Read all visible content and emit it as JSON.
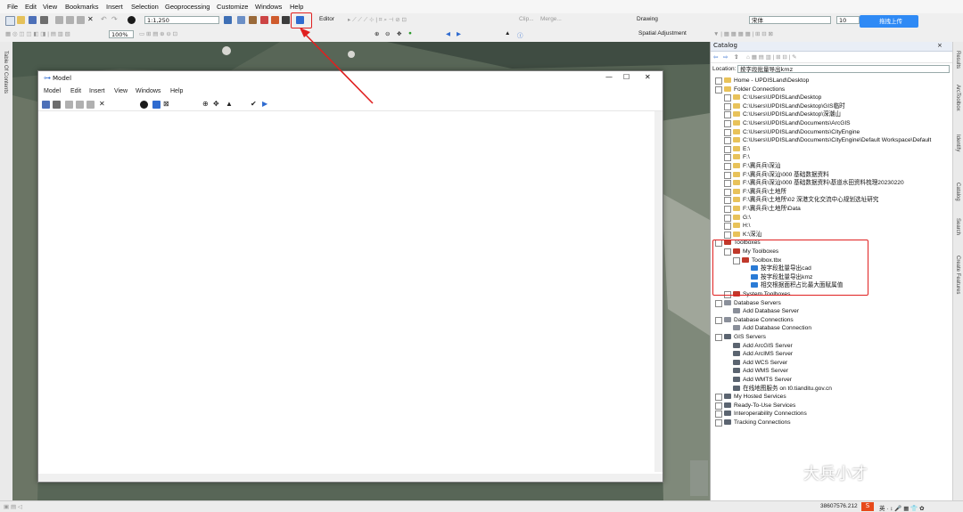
{
  "menu": [
    "File",
    "Edit",
    "View",
    "Bookmarks",
    "Insert",
    "Selection",
    "Geoprocessing",
    "Customize",
    "Windows",
    "Help"
  ],
  "toolbar": {
    "scale": "1:1,250",
    "editor": "Editor",
    "clip": "Clip...",
    "merge": "Merge...",
    "drawing": "Drawing",
    "font_name": "宋体",
    "font_size": "10",
    "zoom": "100%",
    "spatial_adjustment": "Spatial Adjustment",
    "upload_button": "拖拽上传"
  },
  "left_tabs": [
    "Table Of Contents"
  ],
  "model": {
    "title": "Model",
    "menu": [
      "Model",
      "Edit",
      "Insert",
      "View",
      "Windows",
      "Help"
    ],
    "controls": {
      "minimize": "—",
      "maximize": "☐",
      "close": "✕"
    }
  },
  "catalog": {
    "title": "Catalog",
    "location_label": "Location:",
    "location_value": "按字段批量导出kmz",
    "items": [
      {
        "level": 0,
        "exp": "⊞",
        "icon": "folder",
        "label": "Home - UPDISLand\\Desktop"
      },
      {
        "level": 0,
        "exp": "⊟",
        "icon": "folder",
        "label": "Folder Connections"
      },
      {
        "level": 1,
        "exp": "⊞",
        "icon": "folder",
        "label": "C:\\Users\\UPDISLand\\Desktop"
      },
      {
        "level": 1,
        "exp": "⊞",
        "icon": "folder",
        "label": "C:\\Users\\UPDISLand\\Desktop\\GIS临时"
      },
      {
        "level": 1,
        "exp": "⊞",
        "icon": "folder",
        "label": "C:\\Users\\UPDISLand\\Desktop\\深潮山"
      },
      {
        "level": 1,
        "exp": "⊞",
        "icon": "folder",
        "label": "C:\\Users\\UPDISLand\\Documents\\ArcGIS"
      },
      {
        "level": 1,
        "exp": "⊞",
        "icon": "folder",
        "label": "C:\\Users\\UPDISLand\\Documents\\CityEngine"
      },
      {
        "level": 1,
        "exp": "⊞",
        "icon": "folder",
        "label": "C:\\Users\\UPDISLand\\Documents\\CityEngine\\Default Workspace\\Default"
      },
      {
        "level": 1,
        "exp": "⊞",
        "icon": "folder",
        "label": "E:\\"
      },
      {
        "level": 1,
        "exp": "⊞",
        "icon": "folder",
        "label": "F:\\"
      },
      {
        "level": 1,
        "exp": "⊞",
        "icon": "folder",
        "label": "F:\\冀兵兵\\深汕"
      },
      {
        "level": 1,
        "exp": "⊞",
        "icon": "folder",
        "label": "F:\\冀兵兵\\深汕\\000 基础数据资料"
      },
      {
        "level": 1,
        "exp": "⊞",
        "icon": "folder",
        "label": "F:\\冀兵兵\\深汕\\000 基础数据资料\\基道水田资料梳理20230220"
      },
      {
        "level": 1,
        "exp": "⊞",
        "icon": "folder",
        "label": "F:\\冀兵兵\\土地所"
      },
      {
        "level": 1,
        "exp": "⊞",
        "icon": "folder",
        "label": "F:\\冀兵兵\\土地所\\02  深港文化交流中心规划选址研究"
      },
      {
        "level": 1,
        "exp": "⊞",
        "icon": "folder",
        "label": "F:\\冀兵兵\\土地所\\Data"
      },
      {
        "level": 1,
        "exp": "⊞",
        "icon": "folder",
        "label": "G:\\"
      },
      {
        "level": 1,
        "exp": "⊞",
        "icon": "folder",
        "label": "H:\\"
      },
      {
        "level": 1,
        "exp": "⊞",
        "icon": "folder",
        "label": "K:\\深汕"
      },
      {
        "level": 0,
        "exp": "⊟",
        "icon": "toolbox",
        "label": "Toolboxes"
      },
      {
        "level": 1,
        "exp": "⊟",
        "icon": "toolbox",
        "label": "My Toolboxes"
      },
      {
        "level": 2,
        "exp": "⊟",
        "icon": "toolbox",
        "label": "Toolbox.tbx"
      },
      {
        "level": 3,
        "exp": "",
        "icon": "model",
        "label": "按字段批量导出cad"
      },
      {
        "level": 3,
        "exp": "",
        "icon": "model",
        "label": "按字段批量导出kmz"
      },
      {
        "level": 3,
        "exp": "",
        "icon": "model",
        "label": "相交根据面积占比最大面赋属值"
      },
      {
        "level": 1,
        "exp": "⊞",
        "icon": "toolbox",
        "label": "System Toolboxes"
      },
      {
        "level": 0,
        "exp": "⊟",
        "icon": "db",
        "label": "Database Servers"
      },
      {
        "level": 1,
        "exp": "",
        "icon": "db",
        "label": "Add Database Server"
      },
      {
        "level": 0,
        "exp": "⊟",
        "icon": "db",
        "label": "Database Connections"
      },
      {
        "level": 1,
        "exp": "",
        "icon": "db",
        "label": "Add Database Connection"
      },
      {
        "level": 0,
        "exp": "⊟",
        "icon": "server",
        "label": "GIS Servers"
      },
      {
        "level": 1,
        "exp": "",
        "icon": "server",
        "label": "Add ArcGIS Server"
      },
      {
        "level": 1,
        "exp": "",
        "icon": "server",
        "label": "Add ArcIMS Server"
      },
      {
        "level": 1,
        "exp": "",
        "icon": "server",
        "label": "Add WCS Server"
      },
      {
        "level": 1,
        "exp": "",
        "icon": "server",
        "label": "Add WMS Server"
      },
      {
        "level": 1,
        "exp": "",
        "icon": "server",
        "label": "Add WMTS Server"
      },
      {
        "level": 1,
        "exp": "",
        "icon": "server",
        "label": "在线地图服务 on t0.tianditu.gov.cn"
      },
      {
        "level": 0,
        "exp": "⊞",
        "icon": "server",
        "label": "My Hosted Services"
      },
      {
        "level": 0,
        "exp": "⊞",
        "icon": "server",
        "label": "Ready-To-Use Services"
      },
      {
        "level": 0,
        "exp": "⊞",
        "icon": "server",
        "label": "Interoperability Connections"
      },
      {
        "level": 0,
        "exp": "⊞",
        "icon": "server",
        "label": "Tracking Connections"
      }
    ]
  },
  "right_tabs": [
    "Results",
    "ArcToolbox",
    "Identify",
    "Catalog",
    "Search",
    "Create Features"
  ],
  "status": {
    "coords": "38607576.212"
  },
  "watermark": "大兵小才",
  "colors": {
    "accent": "#e02020",
    "folder": "#e8c25a",
    "toolbox": "#c0392b",
    "model": "#2a7bd6"
  }
}
